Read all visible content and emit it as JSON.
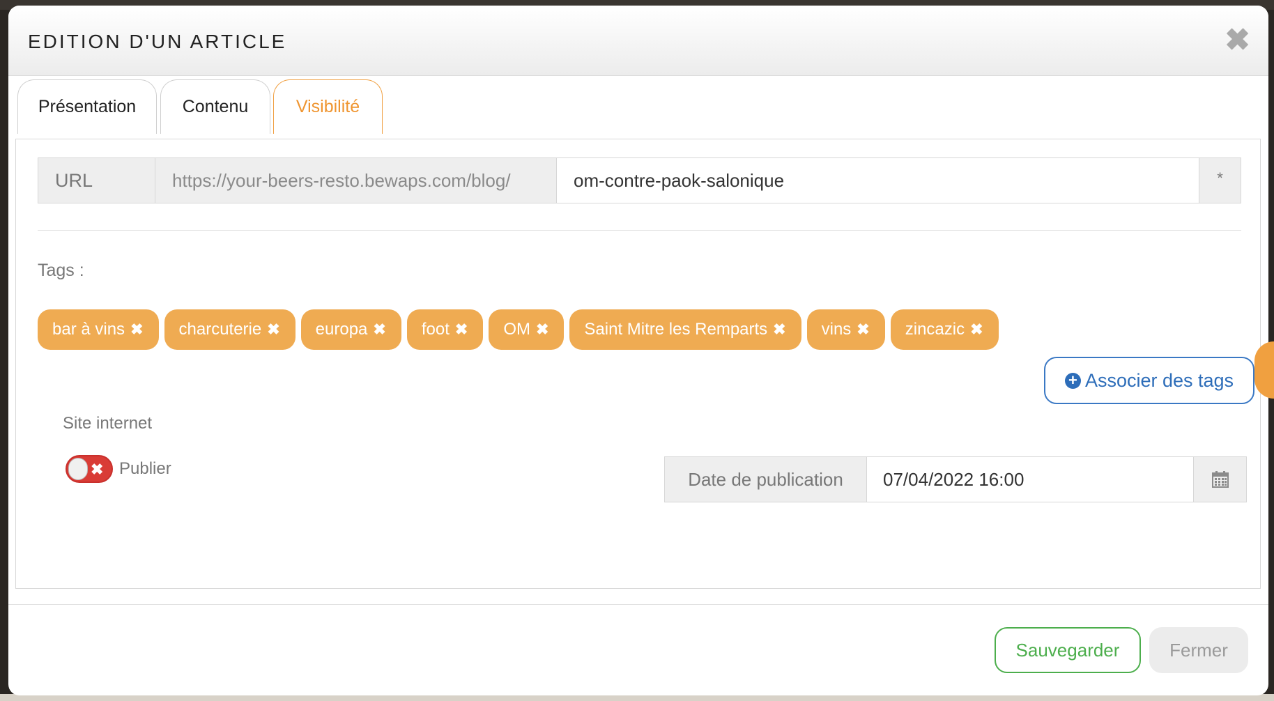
{
  "modal": {
    "title": "EDITION D'UN ARTICLE",
    "close_glyph": "✖"
  },
  "tabs": [
    {
      "label": "Présentation",
      "active": false
    },
    {
      "label": "Contenu",
      "active": false
    },
    {
      "label": "Visibilité",
      "active": true
    }
  ],
  "url": {
    "label": "URL",
    "prefix": "https://your-beers-resto.bewaps.com/blog/",
    "value": "om-contre-paok-salonique",
    "required_mark": "*"
  },
  "tags": {
    "label": "Tags :",
    "items": [
      "bar à vins",
      "charcuterie",
      "europa",
      "foot",
      "OM",
      "Saint Mitre les Remparts",
      "vins",
      "zincazic"
    ],
    "remove_glyph": "✖",
    "associate_button": "Associer des tags"
  },
  "site": {
    "label": "Site internet",
    "publish_label": "Publier",
    "publish_enabled": false
  },
  "publication": {
    "label": "Date de publication",
    "value": "07/04/2022 16:00",
    "calendar_icon": "calendar-icon"
  },
  "footer": {
    "save_label": "Sauvegarder",
    "close_label": "Fermer"
  },
  "colors": {
    "accent_orange": "#efab52",
    "active_tab": "#ef9530",
    "primary_blue": "#2d6db9",
    "success_green": "#4cae4c",
    "toggle_red": "#d93c36"
  }
}
